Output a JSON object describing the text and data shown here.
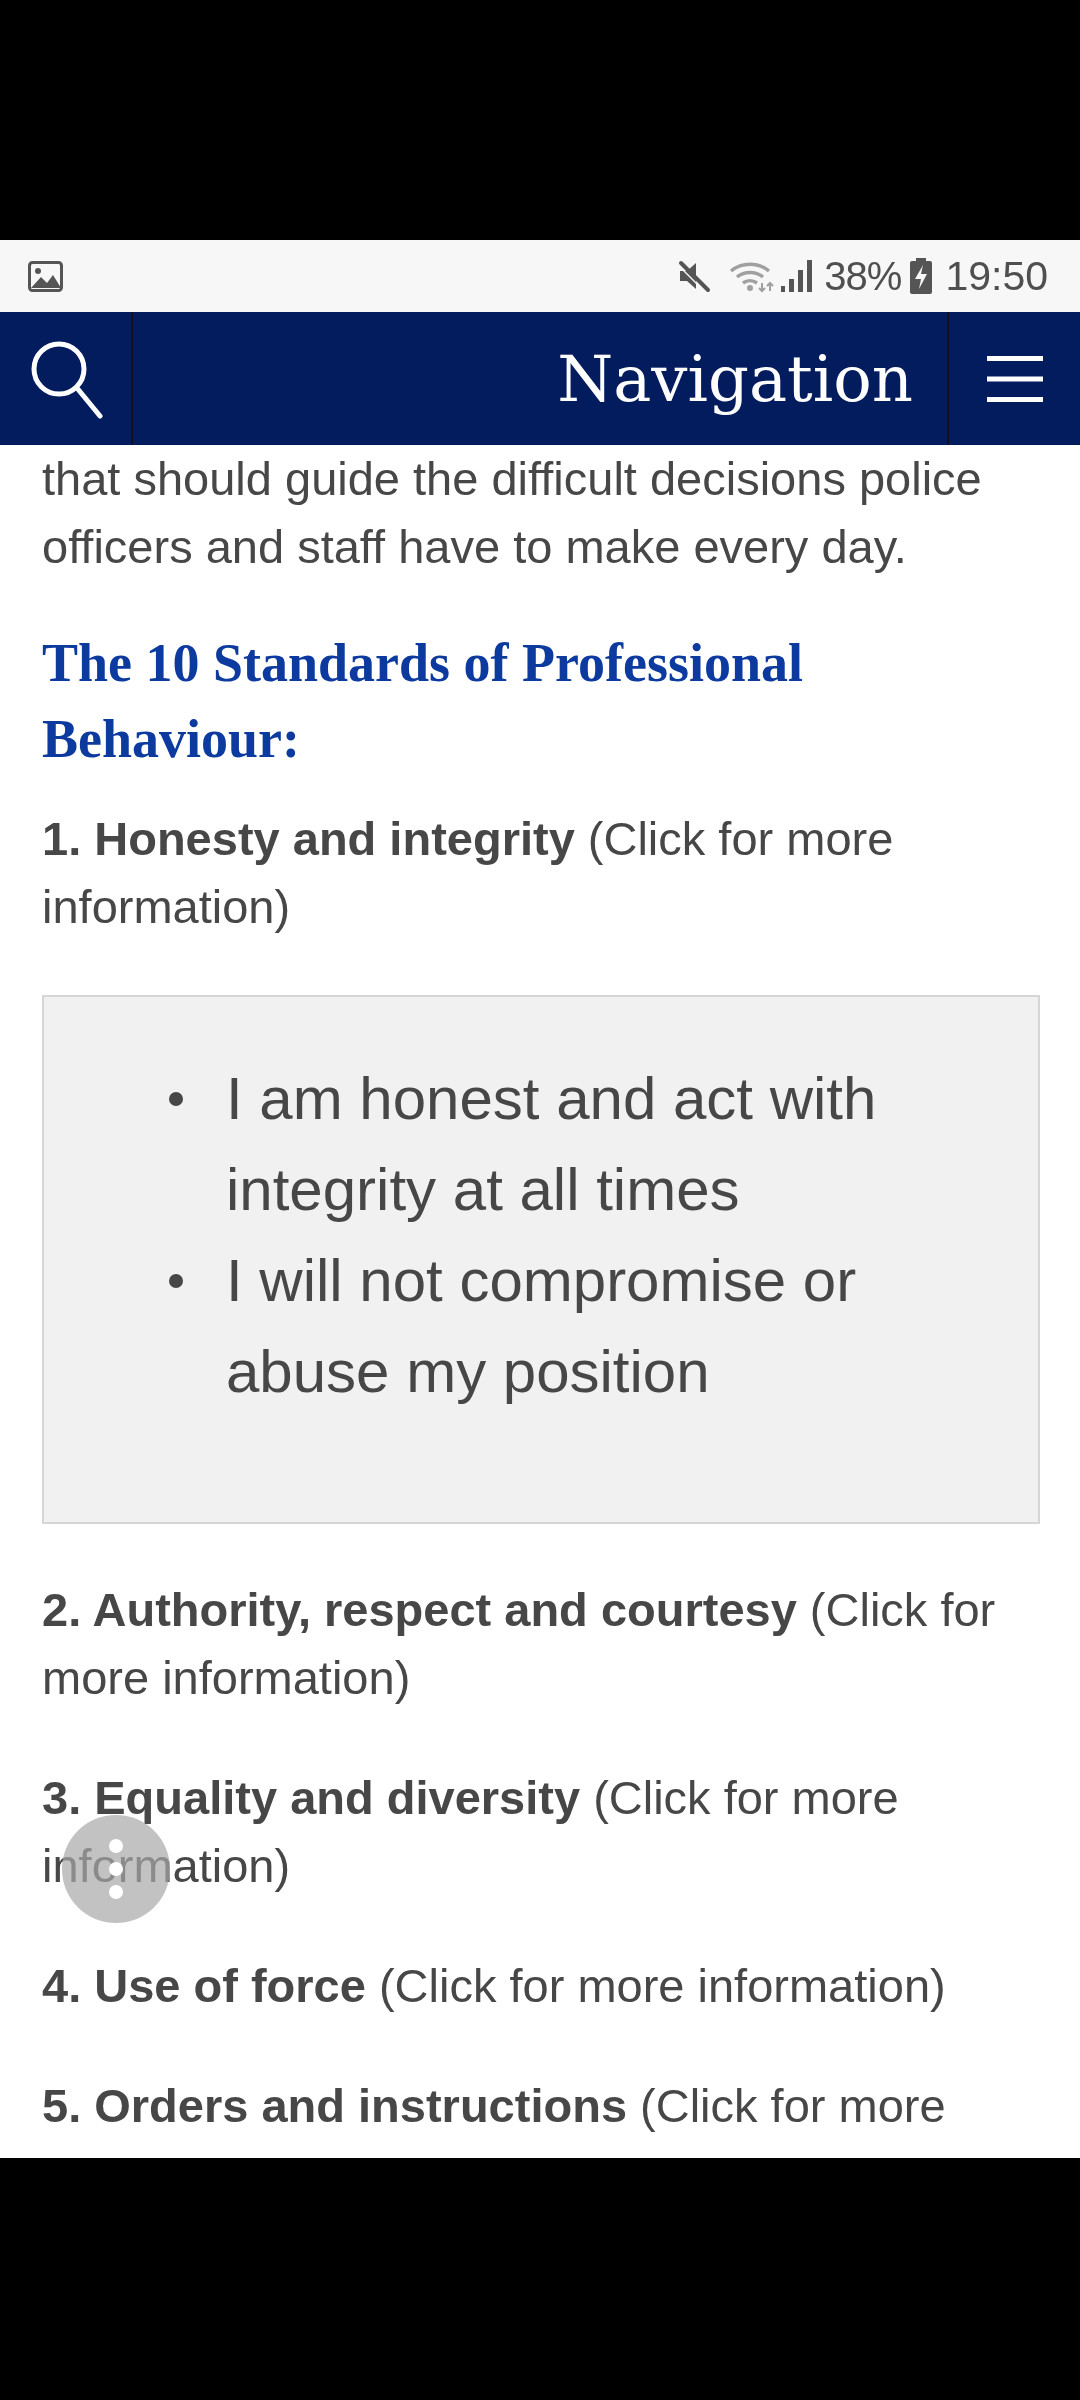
{
  "status_bar": {
    "battery_percent": "38%",
    "time": "19:50"
  },
  "nav_bar": {
    "title": "Navigation"
  },
  "article": {
    "intro": "that should guide the difficult decisions police officers and staff have to make every day.",
    "heading": "The 10 Standards of Professional Behaviour:",
    "standards": [
      {
        "text": "**1. Honesty and integrity** (Click for more information)",
        "expanded": true,
        "points": [
          "I am honest and act with integrity at all times",
          "I will not compromise or abuse my position"
        ]
      },
      {
        "text": "**2. Authority, respect and courtesy** (Click for more information)",
        "expanded": false
      },
      {
        "text": "**3. Equality and diversity** (Click for more information)",
        "expanded": false
      },
      {
        "text": "**4. Use of force** (Click for more information)",
        "expanded": false
      },
      {
        "text": "**5. Orders and instructions** (Click for more",
        "expanded": false
      }
    ]
  }
}
